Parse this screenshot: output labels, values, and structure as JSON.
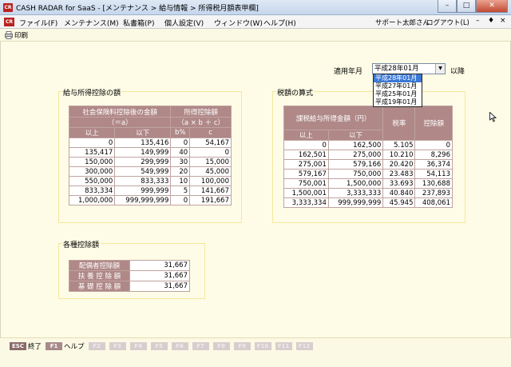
{
  "window": {
    "title": "CASH RADAR for SaaS - [メンテナンス > 給与情報 > 所得税月額表甲欄]",
    "logo": "CR",
    "min": "–",
    "max": "□",
    "close": "✕"
  },
  "menubar": {
    "items": [
      "ファイル(F)",
      "メンテナンス(M)",
      "私書箱(P)",
      "個人設定(V)",
      "ウィンドウ(W)",
      "ヘルプ(H)"
    ],
    "user": "サポート太郎さん",
    "logout": "ログアウト(L)",
    "mdi_min": "–",
    "mdi_restore": "♦",
    "mdi_close": "×"
  },
  "toolbar": {
    "print": "印刷"
  },
  "date": {
    "label": "適用年月",
    "selected": "平成28年01月",
    "after": "以降",
    "options": [
      "平成28年01月",
      "平成27年01月",
      "平成25年01月",
      "平成19年01月"
    ]
  },
  "salary_deduction": {
    "title": "給与所得控除の額",
    "h_amount": "社会保険料控除後の金額",
    "h_amount_sub": "（＝a）",
    "h_ded": "所得控除額",
    "h_ded_sub": "（a × b ＋ c）",
    "h_from": "以上",
    "h_to": "以下",
    "h_b": "b%",
    "h_c": "c",
    "rows": [
      [
        "0",
        "135,416",
        "0",
        "54,167"
      ],
      [
        "135,417",
        "149,999",
        "40",
        "0"
      ],
      [
        "150,000",
        "299,999",
        "30",
        "15,000"
      ],
      [
        "300,000",
        "549,999",
        "20",
        "45,000"
      ],
      [
        "550,000",
        "833,333",
        "10",
        "100,000"
      ],
      [
        "833,334",
        "999,999",
        "5",
        "141,667"
      ],
      [
        "1,000,000",
        "999,999,999",
        "0",
        "191,667"
      ]
    ]
  },
  "tax_formula": {
    "title": "税額の算式",
    "h_taxable": "課税給与所得金額（円）",
    "h_from": "以上",
    "h_to": "以下",
    "h_rate": "税率",
    "h_ded": "控除額",
    "rows": [
      [
        "0",
        "162,500",
        "5.105",
        "0"
      ],
      [
        "162,501",
        "275,000",
        "10.210",
        "8,296"
      ],
      [
        "275,001",
        "579,166",
        "20.420",
        "36,374"
      ],
      [
        "579,167",
        "750,000",
        "23.483",
        "54,113"
      ],
      [
        "750,001",
        "1,500,000",
        "33.693",
        "130,688"
      ],
      [
        "1,500,001",
        "3,333,333",
        "40.840",
        "237,893"
      ],
      [
        "3,333,334",
        "999,999,999",
        "45.945",
        "408,061"
      ]
    ]
  },
  "deductions": {
    "title": "各種控除額",
    "rows": [
      [
        "配偶者控除額",
        "31,667"
      ],
      [
        "扶 養 控 除 額",
        "31,667"
      ],
      [
        "基 礎 控 除 額",
        "31,667"
      ]
    ]
  },
  "fkeys": [
    {
      "key": "ESC",
      "label": "終了",
      "enabled": true
    },
    {
      "key": "F1",
      "label": "ヘルプ",
      "enabled": true
    },
    {
      "key": "F2",
      "label": "",
      "enabled": false
    },
    {
      "key": "F3",
      "label": "",
      "enabled": false
    },
    {
      "key": "F4",
      "label": "",
      "enabled": false
    },
    {
      "key": "F5",
      "label": "",
      "enabled": false
    },
    {
      "key": "F6",
      "label": "",
      "enabled": false
    },
    {
      "key": "F7",
      "label": "",
      "enabled": false
    },
    {
      "key": "F8",
      "label": "",
      "enabled": false
    },
    {
      "key": "F9",
      "label": "",
      "enabled": false
    },
    {
      "key": "F10",
      "label": "",
      "enabled": false
    },
    {
      "key": "F11",
      "label": "",
      "enabled": false
    },
    {
      "key": "F12",
      "label": "",
      "enabled": false
    }
  ],
  "colors": {
    "header_bg": "#b08888",
    "content_bg": "#fefce6",
    "group_border": "#f4e79c",
    "selected": "#3a78d6"
  }
}
